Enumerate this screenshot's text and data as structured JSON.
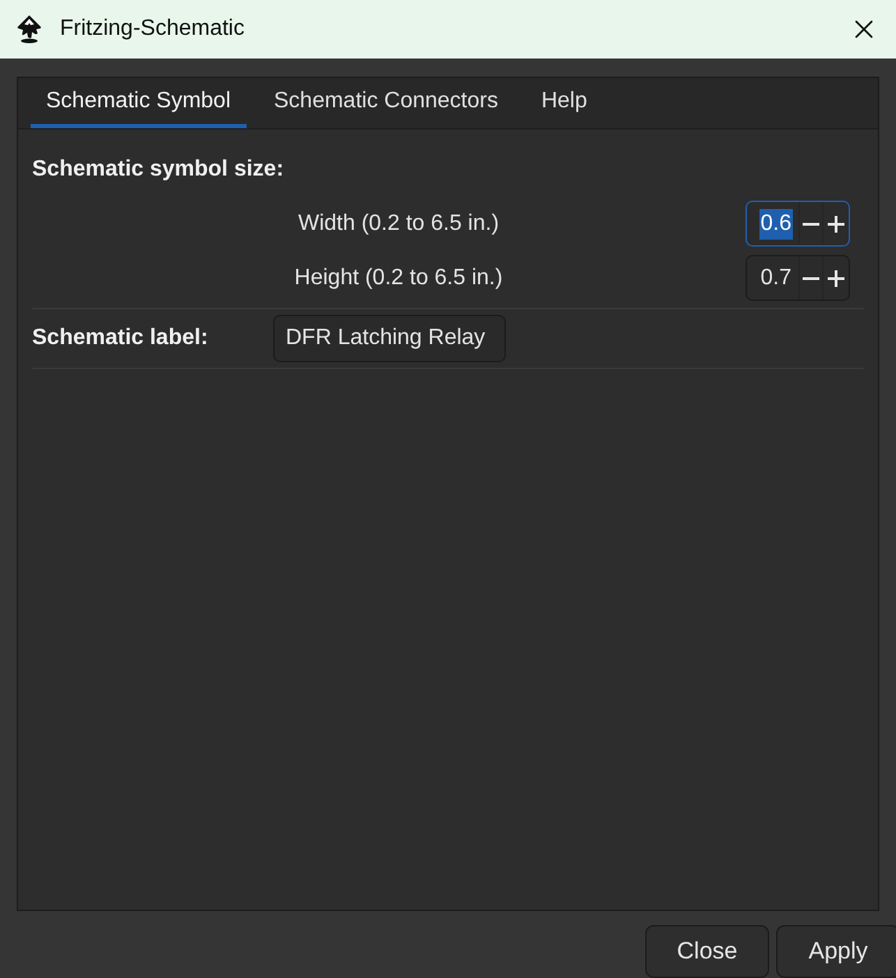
{
  "window": {
    "title": "Fritzing-Schematic"
  },
  "tabs": [
    {
      "label": "Schematic Symbol",
      "selected": true
    },
    {
      "label": "Schematic Connectors",
      "selected": false
    },
    {
      "label": "Help",
      "selected": false
    }
  ],
  "symbol_size": {
    "heading": "Schematic symbol size:",
    "fields": [
      {
        "label": "Width (0.2 to 6.5 in.)",
        "value": "0.6",
        "focused": true
      },
      {
        "label": "Height (0.2 to 6.5 in.)",
        "value": "0.7",
        "focused": false
      }
    ]
  },
  "schematic_label": {
    "label": "Schematic label:",
    "value": "DFR Latching Relay"
  },
  "buttons": [
    "Close",
    "Apply"
  ]
}
